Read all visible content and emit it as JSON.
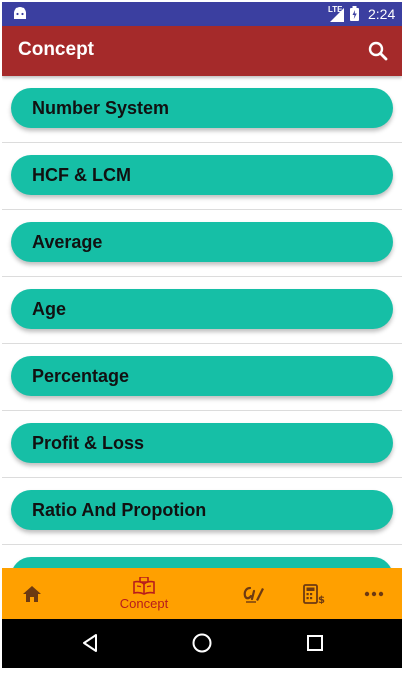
{
  "status_bar": {
    "network_label": "LTE",
    "time": "2:24"
  },
  "app_bar": {
    "title": "Concept",
    "search_icon": "search-icon"
  },
  "topics": [
    {
      "label": "Number System"
    },
    {
      "label": "HCF & LCM"
    },
    {
      "label": "Average"
    },
    {
      "label": "Age"
    },
    {
      "label": "Percentage"
    },
    {
      "label": "Profit & Loss"
    },
    {
      "label": "Ratio And Propotion"
    },
    {
      "label": ""
    }
  ],
  "bottom_nav": {
    "items": [
      {
        "icon": "home-icon",
        "label": ""
      },
      {
        "icon": "book-icon",
        "label": "Concept",
        "selected": true
      },
      {
        "icon": "quiz-pencil-icon",
        "label": ""
      },
      {
        "icon": "calculator-icon",
        "label": ""
      },
      {
        "icon": "more-icon",
        "label": ""
      }
    ]
  },
  "colors": {
    "status_bar": "#3b3fa0",
    "app_bar": "#a52a2a",
    "pill": "#16bfa6",
    "bottom_nav": "#ffa000",
    "nav_icon": "#6d3a12",
    "nav_selected": "#b71c1c"
  }
}
